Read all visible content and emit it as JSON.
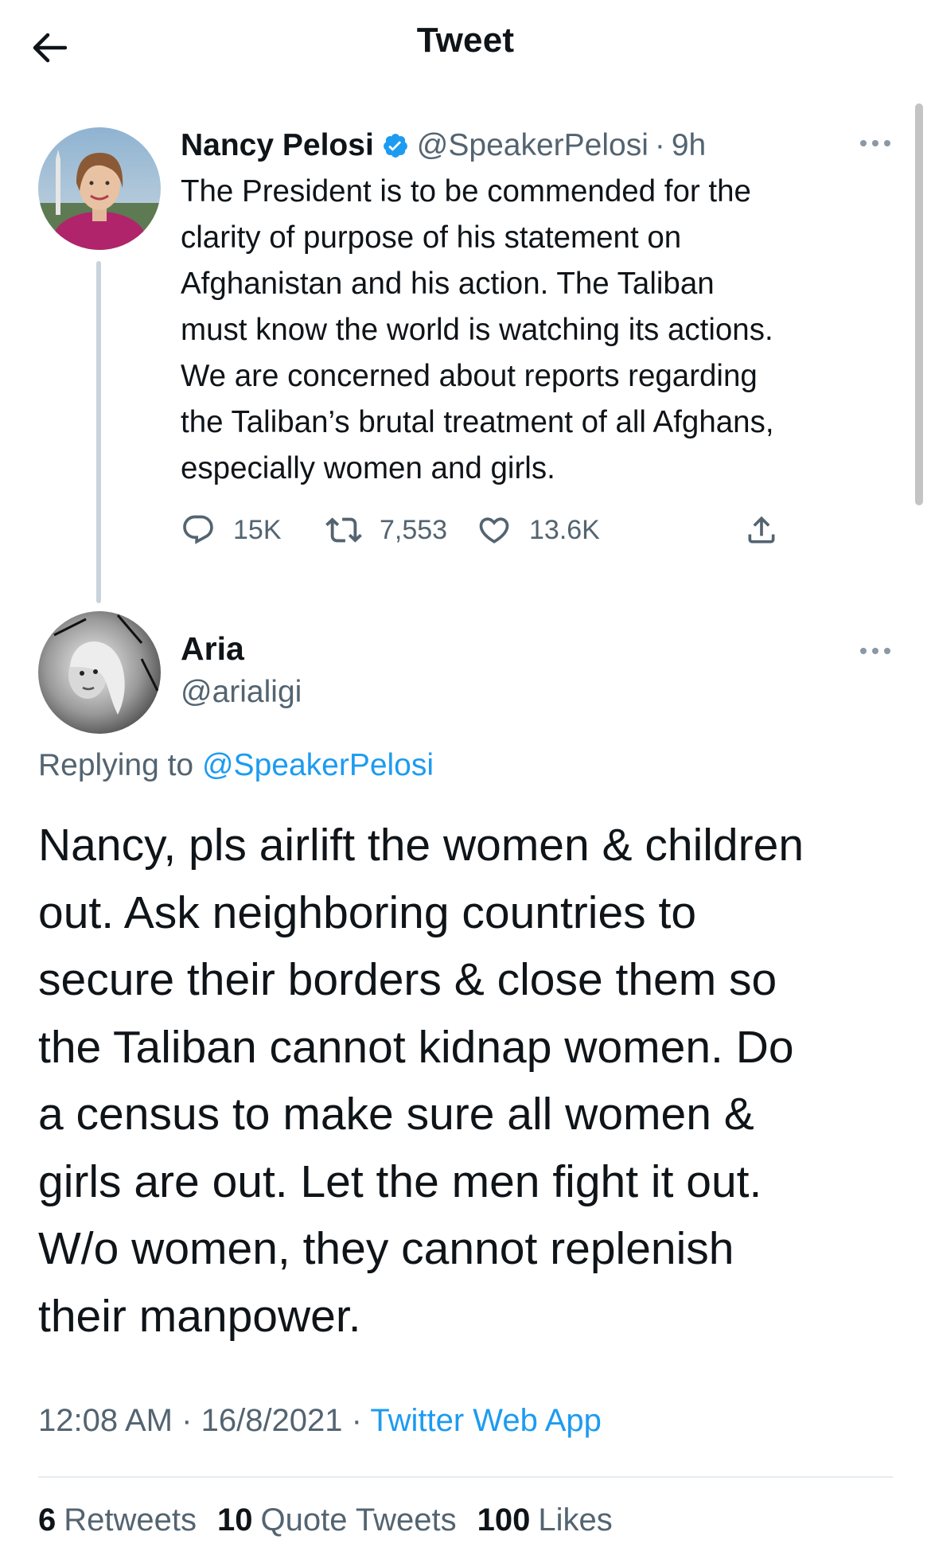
{
  "header": {
    "title": "Tweet",
    "back_icon": "arrow-left-icon"
  },
  "parent_tweet": {
    "author_name": "Nancy Pelosi",
    "verified": true,
    "handle": "@SpeakerPelosi",
    "separator": "·",
    "time": "9h",
    "text_lines": [
      "The President is to be commended for the",
      "clarity of purpose of his statement on",
      "Afghanistan and his action. The Taliban",
      "must know the world is watching its actions.",
      "We are concerned about reports regarding",
      "the Taliban’s brutal treatment of all Afghans,",
      "especially women and girls."
    ],
    "actions": {
      "replies": "15K",
      "retweets": "7,553",
      "likes": "13.6K"
    }
  },
  "reply_tweet": {
    "author_name": "Aria",
    "handle": "@arialigi",
    "replying_prefix": "Replying to",
    "replying_to": "@SpeakerPelosi",
    "text_lines": [
      "Nancy, pls airlift the women & children",
      "out. Ask neighboring countries to",
      "secure their borders & close them so",
      "the Taliban cannot kidnap women. Do",
      "a census to make sure all women &",
      "girls are out. Let the men fight it out.",
      "W/o women, they cannot replenish",
      "their manpower."
    ],
    "meta": {
      "time": "12:08 AM",
      "separator": "·",
      "date": "16/8/2021",
      "source": "Twitter Web App"
    },
    "stats": {
      "retweets_count": "6",
      "retweets_label": "Retweets",
      "quote_count": "10",
      "quote_label": "Quote Tweets",
      "likes_count": "100",
      "likes_label": "Likes"
    }
  },
  "colors": {
    "text": "#0f1419",
    "secondary": "#536471",
    "accent": "#1d9bf0",
    "thread_line": "#c9d3da"
  }
}
